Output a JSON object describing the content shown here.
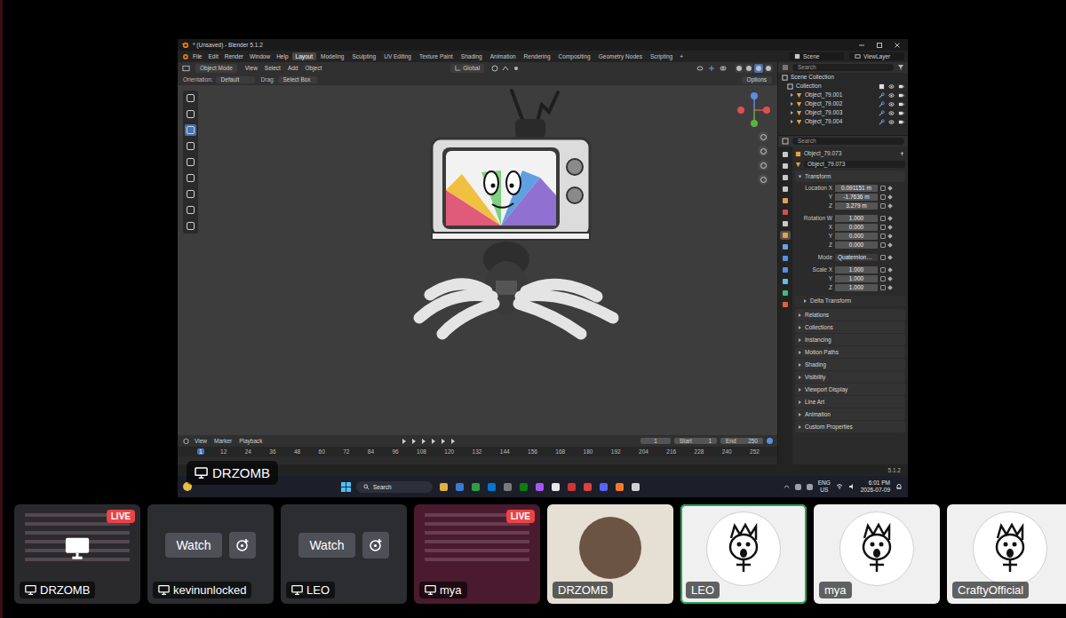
{
  "stream": {
    "presenter": "DRZOMB",
    "blender": {
      "title": "* (Unsaved) - Blender 5.1.2",
      "menus": [
        "File",
        "Edit",
        "Render",
        "Window",
        "Help"
      ],
      "workspaces": [
        {
          "label": "Layout",
          "selected": true
        },
        {
          "label": "Modeling",
          "selected": false
        },
        {
          "label": "Sculpting",
          "selected": false
        },
        {
          "label": "UV Editing",
          "selected": false
        },
        {
          "label": "Texture Paint",
          "selected": false
        },
        {
          "label": "Shading",
          "selected": false
        },
        {
          "label": "Animation",
          "selected": false
        },
        {
          "label": "Rendering",
          "selected": false
        },
        {
          "label": "Compositing",
          "selected": false
        },
        {
          "label": "Geometry Nodes",
          "selected": false
        },
        {
          "label": "Scripting",
          "selected": false
        }
      ],
      "add_workspace": "+",
      "scene": "Scene",
      "view_layer": "ViewLayer",
      "viewport_header": {
        "mode": "Object Mode",
        "menus": [
          "View",
          "Select",
          "Add",
          "Object"
        ],
        "orientation": "Global",
        "shading_modes": [
          {
            "selected": false
          },
          {
            "selected": false
          },
          {
            "selected": true
          },
          {
            "selected": false
          }
        ]
      },
      "tool_settings": {
        "orientation_label": "Orientation:",
        "orientation": "Default",
        "drag_label": "Drag:",
        "drag": "Select Box",
        "options": "Options"
      },
      "toolbar": [
        {
          "selected": false
        },
        {
          "selected": false
        },
        {
          "selected": true
        },
        {
          "selected": false
        },
        {
          "selected": false
        },
        {
          "selected": false
        },
        {
          "selected": false
        },
        {
          "selected": false
        },
        {
          "selected": false
        }
      ],
      "outliner": {
        "search": "Search",
        "items": [
          {
            "label": "Scene Collection",
            "kind": "scene"
          },
          {
            "label": "Collection",
            "kind": "collection"
          },
          {
            "label": "Object_79.001",
            "kind": "object"
          },
          {
            "label": "Object_79.002",
            "kind": "object"
          },
          {
            "label": "Object_79.003",
            "kind": "object"
          },
          {
            "label": "Object_79.004",
            "kind": "object"
          }
        ]
      },
      "properties": {
        "search": "Search",
        "tabs": [
          {
            "color": "#c8c8c8",
            "selected": false
          },
          {
            "color": "#c8c8c8",
            "selected": false
          },
          {
            "color": "#c8c8c8",
            "selected": false
          },
          {
            "color": "#c8c8c8",
            "selected": false
          },
          {
            "color": "#d9a45a",
            "selected": false
          },
          {
            "color": "#d05050",
            "selected": false
          },
          {
            "color": "#c8c8c8",
            "selected": false
          },
          {
            "color": "#e8a040",
            "selected": true
          },
          {
            "color": "#6fa0e0",
            "selected": false
          },
          {
            "color": "#5a8fe0",
            "selected": false
          },
          {
            "color": "#5a8fe0",
            "selected": false
          },
          {
            "color": "#60c0e0",
            "selected": false
          },
          {
            "color": "#40c070",
            "selected": false
          },
          {
            "color": "#e06040",
            "selected": false
          }
        ],
        "object": "Object_79.073",
        "datablock": "Object_79.073",
        "transform": {
          "label": "Transform",
          "expanded": true,
          "groups": [
            {
              "kind": "fields",
              "rows": [
                {
                  "label": "Location X",
                  "value": "0.091151 m"
                },
                {
                  "label": "Y",
                  "value": "-1.7636 m"
                },
                {
                  "label": "Z",
                  "value": "3.279 m"
                }
              ]
            },
            {
              "kind": "fields",
              "rows": [
                {
                  "label": "Rotation W",
                  "value": "1.000"
                },
                {
                  "label": "X",
                  "value": "0.000"
                },
                {
                  "label": "Y",
                  "value": "0.000"
                },
                {
                  "label": "Z",
                  "value": "0.000"
                }
              ]
            },
            {
              "kind": "dropdown",
              "rows": [
                {
                  "label": "Mode",
                  "value": "Quaternion…"
                }
              ]
            },
            {
              "kind": "fields",
              "rows": [
                {
                  "label": "Scale X",
                  "value": "1.000"
                },
                {
                  "label": "Y",
                  "value": "1.000"
                },
                {
                  "label": "Z",
                  "value": "1.000"
                }
              ]
            }
          ],
          "subsections": [
            {
              "label": "Delta Transform",
              "expanded": false
            }
          ]
        },
        "sections": [
          {
            "label": "Relations",
            "expanded": false
          },
          {
            "label": "Collections",
            "expanded": false
          },
          {
            "label": "Instancing",
            "expanded": false
          },
          {
            "label": "Motion Paths",
            "expanded": false
          },
          {
            "label": "Shading",
            "expanded": false
          },
          {
            "label": "Visibility",
            "expanded": false
          },
          {
            "label": "Viewport Display",
            "expanded": false
          },
          {
            "label": "Line Art",
            "expanded": false
          },
          {
            "label": "Animation",
            "expanded": false
          },
          {
            "label": "Custom Properties",
            "expanded": false
          }
        ]
      },
      "timeline": {
        "menus": [
          "View",
          "Marker",
          "Playback"
        ],
        "frame": "1",
        "start_label": "Start",
        "start": "1",
        "end_label": "End",
        "end": "250",
        "ruler": [
          {
            "label": "1",
            "selected": true
          },
          {
            "label": "12",
            "selected": false
          },
          {
            "label": "24",
            "selected": false
          },
          {
            "label": "36",
            "selected": false
          },
          {
            "label": "48",
            "selected": false
          },
          {
            "label": "60",
            "selected": false
          },
          {
            "label": "72",
            "selected": false
          },
          {
            "label": "84",
            "selected": false
          },
          {
            "label": "96",
            "selected": false
          },
          {
            "label": "108",
            "selected": false
          },
          {
            "label": "120",
            "selected": false
          },
          {
            "label": "132",
            "selected": false
          },
          {
            "label": "144",
            "selected": false
          },
          {
            "label": "156",
            "selected": false
          },
          {
            "label": "168",
            "selected": false
          },
          {
            "label": "180",
            "selected": false
          },
          {
            "label": "192",
            "selected": false
          },
          {
            "label": "204",
            "selected": false
          },
          {
            "label": "216",
            "selected": false
          },
          {
            "label": "228",
            "selected": false
          },
          {
            "label": "240",
            "selected": false
          },
          {
            "label": "252",
            "selected": false
          }
        ]
      },
      "status": {
        "version": "5.1.2"
      }
    },
    "taskbar": {
      "search": "Search",
      "apps": [
        {
          "color": "#e0b040"
        },
        {
          "color": "#3a7bd5"
        },
        {
          "color": "#2f9e44"
        },
        {
          "color": "#0078d4"
        },
        {
          "color": "#7a7a7a"
        },
        {
          "color": "#107c10"
        },
        {
          "color": "#a855f7"
        },
        {
          "color": "#e8e8e8"
        },
        {
          "color": "#d13438"
        },
        {
          "color": "#e04040"
        },
        {
          "color": "#5865f2"
        },
        {
          "color": "#f5792a"
        },
        {
          "color": "#d0d0d0"
        }
      ],
      "language": "ENG",
      "region": "US",
      "time": "6:01 PM",
      "date": "2026-07-09"
    }
  },
  "tiles": [
    {
      "kind": "live",
      "name": "DRZOMB",
      "badge": "LIVE",
      "speaking": false,
      "focused": true,
      "color": "#2a2a2d"
    },
    {
      "kind": "watch",
      "name": "kevinunlocked",
      "button": "Watch",
      "speaking": false,
      "focused": false,
      "color": "#2b2d31"
    },
    {
      "kind": "watch",
      "name": "LEO",
      "button": "Watch",
      "speaking": false,
      "focused": false,
      "color": "#2b2d31"
    },
    {
      "kind": "live",
      "name": "mya",
      "badge": "LIVE",
      "speaking": false,
      "focused": false,
      "color": "#4a1a2e"
    },
    {
      "kind": "photo",
      "name": "DRZOMB",
      "speaking": false,
      "focused": false,
      "color": "#e6e0d4"
    },
    {
      "kind": "avatar",
      "name": "LEO",
      "speaking": true,
      "focused": false,
      "color": "#f0f0f0"
    },
    {
      "kind": "avatar",
      "name": "mya",
      "speaking": false,
      "focused": false,
      "color": "#f0f0f0"
    },
    {
      "kind": "avatar",
      "name": "CraftyOfficial",
      "speaking": false,
      "focused": false,
      "color": "#f0f0f0"
    }
  ]
}
